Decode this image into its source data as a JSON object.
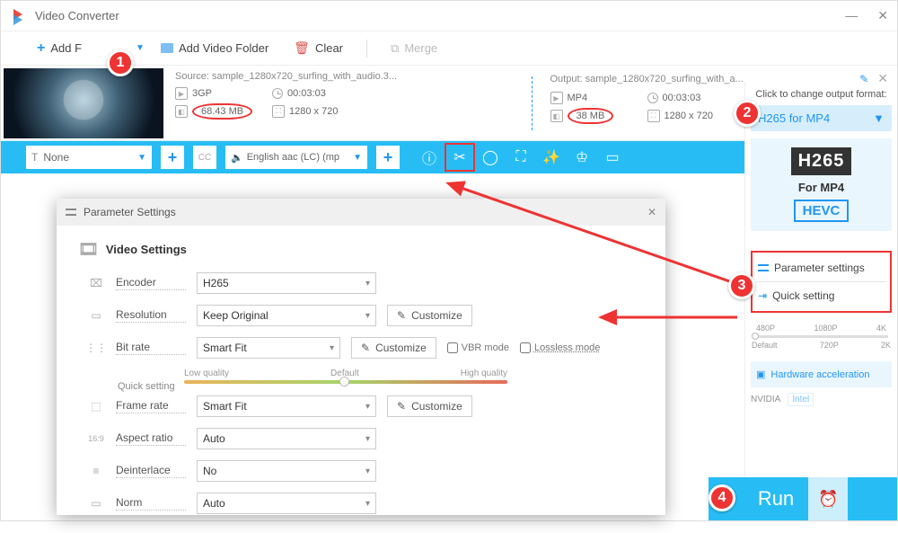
{
  "app": {
    "title": "Video Converter"
  },
  "toolbar": {
    "add_file": "Add F",
    "add_folder": "Add Video Folder",
    "clear": "Clear",
    "merge": "Merge"
  },
  "item": {
    "source": {
      "label": "Source: sample_1280x720_surfing_with_audio.3...",
      "format": "3GP",
      "duration": "00:03:03",
      "size": "68.43 MB",
      "dimensions": "1280 x 720"
    },
    "output": {
      "label": "Output: sample_1280x720_surfing_with_a...",
      "format": "MP4",
      "duration": "00:03:03",
      "size": "38 MB",
      "dimensions": "1280 x 720"
    }
  },
  "bluebar": {
    "subtitle": "None",
    "audio": "English aac (LC) (mp"
  },
  "right": {
    "change_label": "Click to change output format:",
    "format_selected": "H265 for MP4",
    "card": {
      "codec": "H265",
      "container": "For MP4",
      "alt": "HEVC"
    },
    "param_settings": "Parameter settings",
    "quick_setting": "Quick setting",
    "res": {
      "t1": "480P",
      "t2": "1080P",
      "t3": "4K",
      "b1": "Default",
      "b2": "720P",
      "b3": "2K"
    },
    "hw": "Hardware acceleration",
    "gpu1": "NVIDIA",
    "gpu2": "Intel",
    "run": "Run"
  },
  "dialog": {
    "title": "Parameter Settings",
    "section": "Video Settings",
    "labels": {
      "encoder": "Encoder",
      "resolution": "Resolution",
      "bitrate": "Bit rate",
      "quick": "Quick setting",
      "low": "Low quality",
      "default": "Default",
      "high": "High quality",
      "vbr": "VBR mode",
      "lossless": "Lossless mode",
      "framerate": "Frame rate",
      "aspect": "Aspect ratio",
      "deinterlace": "Deinterlace",
      "norm": "Norm",
      "customize": "Customize"
    },
    "values": {
      "encoder": "H265",
      "resolution": "Keep Original",
      "bitrate": "Smart Fit",
      "framerate": "Smart Fit",
      "aspect": "Auto",
      "deinterlace": "No",
      "norm": "Auto"
    }
  },
  "badges": {
    "b1": "1",
    "b2": "2",
    "b3": "3",
    "b4": "4"
  }
}
